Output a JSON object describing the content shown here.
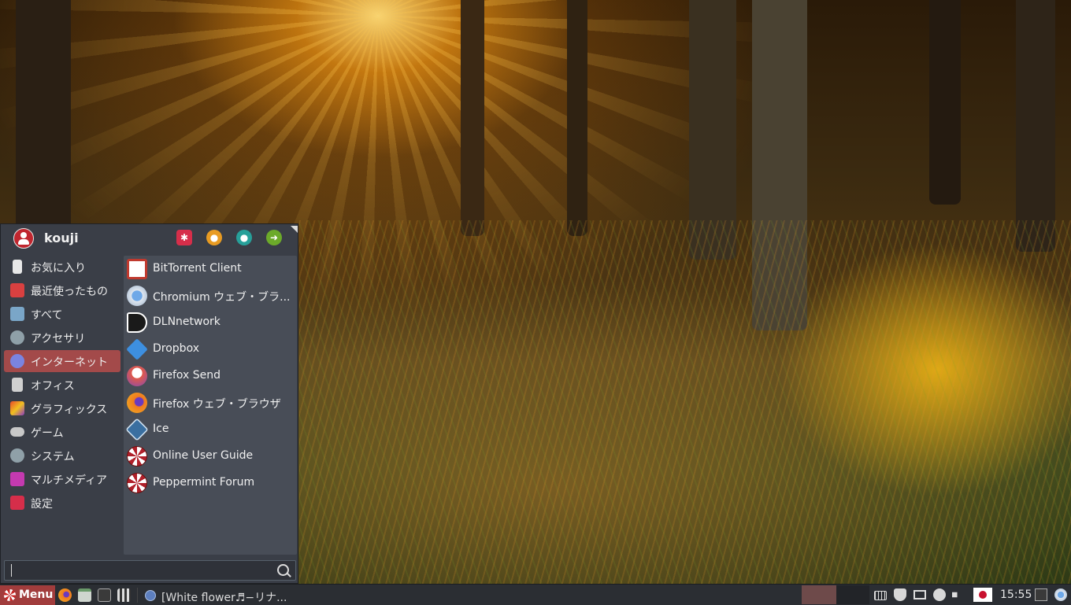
{
  "user": {
    "name": "kouji"
  },
  "menu": {
    "header_buttons": [
      "settings-icon",
      "lock-icon",
      "user-icon",
      "logout-icon"
    ],
    "categories": [
      {
        "label": "お気に入り",
        "icon": "bookmark-icon",
        "color": "#e8e8e8"
      },
      {
        "label": "最近使ったもの",
        "icon": "clock-icon",
        "color": "#d94040"
      },
      {
        "label": "すべて",
        "icon": "all-apps-icon",
        "color": "#7aa6c8"
      },
      {
        "label": "アクセサリ",
        "icon": "gear-icon",
        "color": "#8fa0a8"
      },
      {
        "label": "インターネット",
        "icon": "globe-icon",
        "color": "#7a84e0"
      },
      {
        "label": "オフィス",
        "icon": "document-icon",
        "color": "#d0d0d0"
      },
      {
        "label": "グラフィックス",
        "icon": "graphics-icon",
        "color": "#e86a2a"
      },
      {
        "label": "ゲーム",
        "icon": "gamepad-icon",
        "color": "#c8c8c8"
      },
      {
        "label": "システム",
        "icon": "gear-icon",
        "color": "#8fa0a8"
      },
      {
        "label": "マルチメディア",
        "icon": "media-icon",
        "color": "#c43ab0"
      },
      {
        "label": "設定",
        "icon": "settings-icon",
        "color": "#d62e4a"
      }
    ],
    "active_category": "インターネット",
    "apps": [
      {
        "label": "BitTorrent Client",
        "icon": "bittorrent-icon",
        "color": "#c03a2f"
      },
      {
        "label": "Chromium ウェブ・ブラ...",
        "icon": "chromium-icon",
        "color": "#4b86c9"
      },
      {
        "label": "DLNnetwork",
        "icon": "dlnnetwork-icon",
        "color": "#e8a020"
      },
      {
        "label": "Dropbox",
        "icon": "dropbox-icon",
        "color": "#3d8fe0"
      },
      {
        "label": "Firefox Send",
        "icon": "firefox-send-icon",
        "color": "#e05a4a"
      },
      {
        "label": "Firefox ウェブ・ブラウザ",
        "icon": "firefox-icon",
        "color": "#f07a20"
      },
      {
        "label": "Ice",
        "icon": "ice-icon",
        "color": "#3a6fa0"
      },
      {
        "label": "Online User Guide",
        "icon": "peppermint-icon",
        "color": "#b0202a"
      },
      {
        "label": "Peppermint Forum",
        "icon": "peppermint-icon",
        "color": "#b0202a"
      }
    ],
    "search": {
      "value": "",
      "placeholder": ""
    }
  },
  "taskbar": {
    "menu_label": "Menu",
    "launchers": [
      "firefox-icon",
      "file-manager-icon",
      "terminal-icon",
      "media-player-icon"
    ],
    "active_task": "[White flower♬−リナ...",
    "tray_icons": [
      "keyboard-icon",
      "shield-icon",
      "display-icon",
      "network-icon",
      "volume-icon",
      "japan-flag-icon"
    ],
    "clock": "15:55",
    "extra_icons": [
      "terminal-icon",
      "chromium-icon"
    ]
  }
}
